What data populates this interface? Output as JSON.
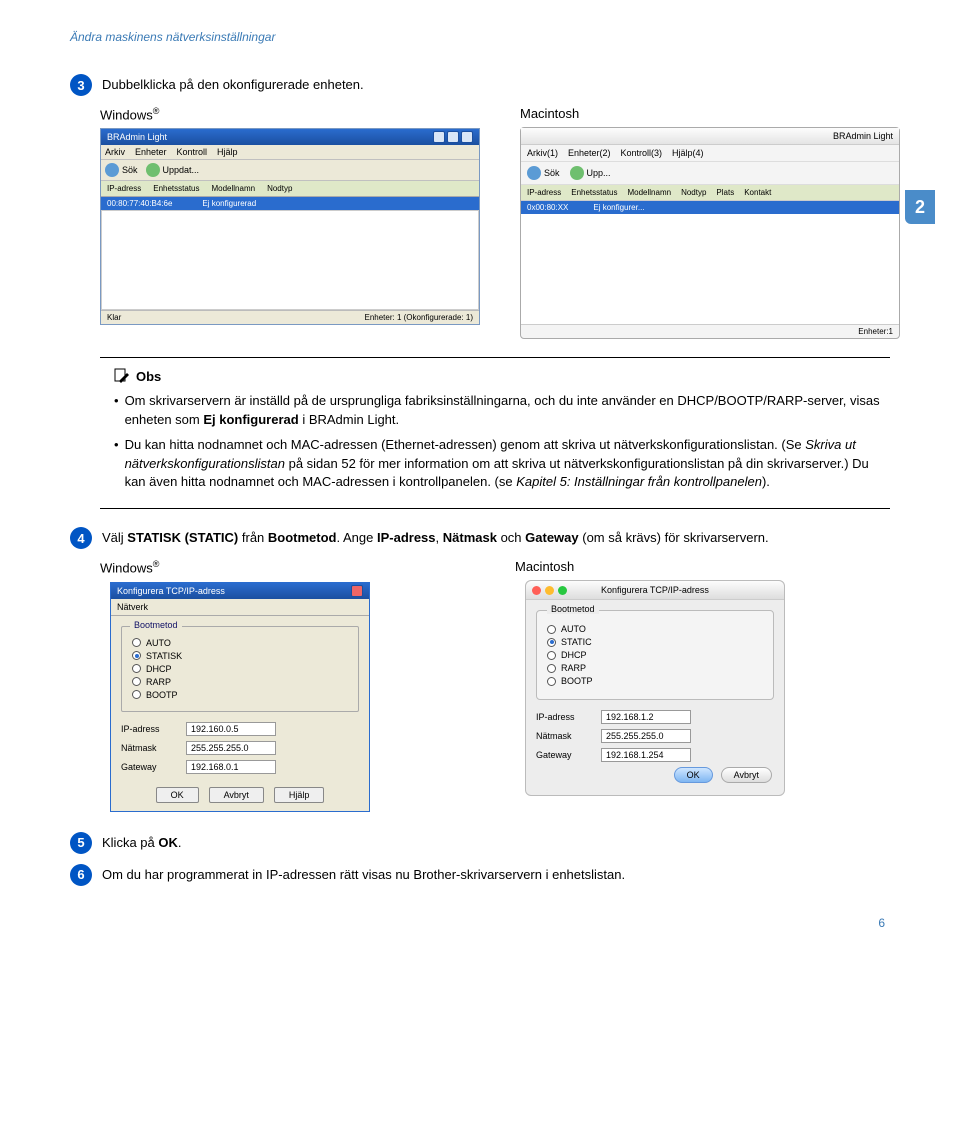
{
  "breadcrumb": "Ändra maskinens nätverksinställningar",
  "chapter_badge": "2",
  "page_number": "6",
  "os": {
    "windows": "Windows",
    "macintosh": "Macintosh",
    "reg": "®"
  },
  "steps": {
    "s3": {
      "num": "3",
      "text": "Dubbelklicka på den okonfigurerade enheten."
    },
    "s4": {
      "num": "4",
      "prefix": "Välj ",
      "static": "STATISK (STATIC)",
      "mid1": " från ",
      "bootmetod": "Bootmetod",
      "mid2": ". Ange ",
      "ip": "IP-adress",
      "comma1": ", ",
      "netmask": "Nätmask",
      "and": " och ",
      "gateway": "Gateway",
      "tail": " (om så krävs) för skrivarservern."
    },
    "s5": {
      "num": "5",
      "prefix": "Klicka på ",
      "ok": "OK",
      "suffix": "."
    },
    "s6": {
      "num": "6",
      "text": "Om du har programmerat in IP-adressen rätt visas nu Brother-skrivarservern i enhetslistan."
    }
  },
  "note": {
    "title": "Obs",
    "li1_a": "Om skrivarservern är inställd på de ursprungliga fabriksinställningarna, och du inte använder en DHCP/BOOTP/RARP-server, visas enheten som ",
    "li1_b": "Ej konfigurerad",
    "li1_c": " i BRAdmin Light.",
    "li2_a": "Du kan hitta nodnamnet och MAC-adressen (Ethernet-adressen) genom att skriva ut nätverkskonfigurationslistan. (Se ",
    "li2_b": "Skriva ut nätverkskonfigurationslistan",
    "li2_c": " på sidan 52 för mer information om att skriva ut nätverkskonfigurationslistan på din skrivarserver.) Du kan även hitta nodnamnet och MAC-adressen i kontrollpanelen. (se ",
    "li2_d": "Kapitel 5: Inställningar från kontrollpanelen",
    "li2_e": ")."
  },
  "win_app": {
    "title": "BRAdmin Light",
    "menu": [
      "Arkiv",
      "Enheter",
      "Kontroll",
      "Hjälp"
    ],
    "tool": {
      "sok": "Sök",
      "uppdat": "Uppdat..."
    },
    "cols": [
      "IP-adress",
      "Enhetsstatus",
      "Modellnamn",
      "Nodtyp"
    ],
    "row": {
      "mac": "00:80:77:40:B4:6e",
      "status": "Ej konfigurerad"
    },
    "status_left": "Klar",
    "status_right": "Enheter: 1 (Okonfigurerade: 1)"
  },
  "mac_app": {
    "title": "BRAdmin Light",
    "menu": [
      "Arkiv(1)",
      "Enheter(2)",
      "Kontroll(3)",
      "Hjälp(4)"
    ],
    "tool": {
      "sok": "Sök",
      "uppd": "Upp..."
    },
    "cols": [
      "IP-adress",
      "Enhetsstatus",
      "Modellnamn",
      "Nodtyp",
      "Plats",
      "Kontakt"
    ],
    "row": {
      "mac": "0x00:80:XX",
      "status": "Ej konfigurer..."
    },
    "status": "Enheter:1"
  },
  "win_dialog": {
    "title": "Konfigurera TCP/IP-adress",
    "tab": "Nätverk",
    "group": "Bootmetod",
    "opts": [
      "AUTO",
      "STATISK",
      "DHCP",
      "RARP",
      "BOOTP"
    ],
    "selected": 1,
    "ip_lbl": "IP-adress",
    "ip_val": "192.160.0.5",
    "mask_lbl": "Nätmask",
    "mask_val": "255.255.255.0",
    "gw_lbl": "Gateway",
    "gw_val": "192.168.0.1",
    "btns": [
      "OK",
      "Avbryt",
      "Hjälp"
    ]
  },
  "mac_dialog": {
    "title": "Konfigurera TCP/IP-adress",
    "group": "Bootmetod",
    "opts": [
      "AUTO",
      "STATIC",
      "DHCP",
      "RARP",
      "BOOTP"
    ],
    "selected": 1,
    "ip_lbl": "IP-adress",
    "ip_val": "192.168.1.2",
    "mask_lbl": "Nätmask",
    "mask_val": "255.255.255.0",
    "gw_lbl": "Gateway",
    "gw_val": "192.168.1.254",
    "btns": {
      "ok": "OK",
      "cancel": "Avbryt"
    }
  }
}
